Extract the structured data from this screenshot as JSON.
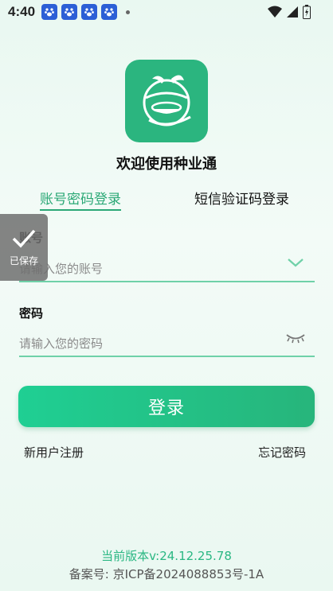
{
  "status_bar": {
    "time": "4:40",
    "app_icons": [
      "baidu-icon",
      "baidu-icon",
      "baidu-icon",
      "baidu-icon"
    ]
  },
  "header": {
    "welcome": "欢迎使用种业通"
  },
  "tabs": [
    {
      "label": "账号密码登录",
      "active": true
    },
    {
      "label": "短信验证码登录",
      "active": false
    }
  ],
  "form": {
    "account_label": "账号",
    "account_placeholder": "请输入您的账号",
    "password_label": "密码",
    "password_placeholder": "请输入您的密码"
  },
  "actions": {
    "login_label": "登录",
    "register_label": "新用户注册",
    "forgot_label": "忘记密码"
  },
  "footer": {
    "version": "当前版本v:24.12.25.78",
    "icp": "备案号: 京ICP备2024088853号-1A"
  },
  "toast": {
    "saved_label": "已保存"
  },
  "colors": {
    "accent": "#2ba876",
    "button_start": "#1fcf93",
    "button_end": "#27b57b"
  }
}
